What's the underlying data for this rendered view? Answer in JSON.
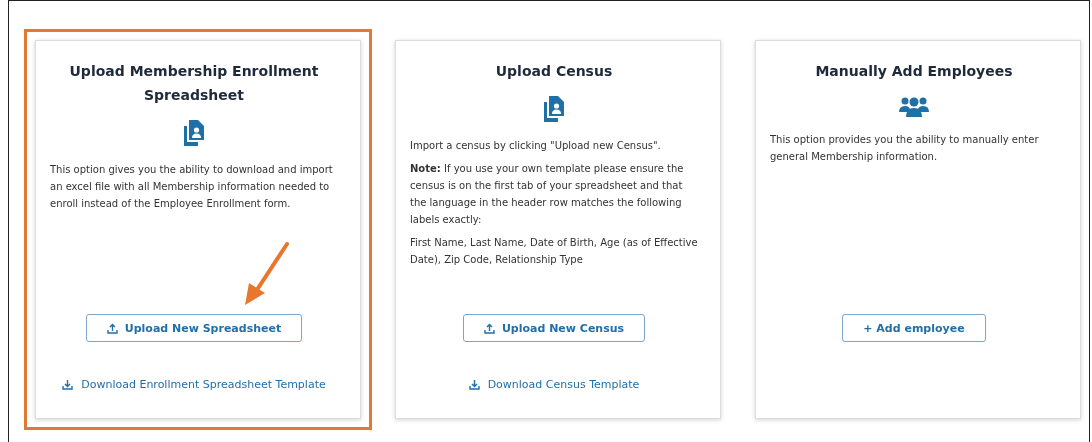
{
  "cards": [
    {
      "title": "Upload Membership Enrollment Spreadsheet",
      "highlighted": true,
      "pointer_arrow": true,
      "kind": "document",
      "paragraphs": [
        "This option gives you the ability to download and import an excel file with all Membership information needed to enroll instead of the Employee Enrollment form."
      ],
      "button": {
        "label": "Upload New Spreadsheet",
        "kind": "upload"
      },
      "link": {
        "label": "Download Enrollment Spreadsheet Template"
      }
    },
    {
      "title": "Upload Census",
      "highlighted": false,
      "pointer_arrow": false,
      "kind": "document",
      "paragraphs": [
        "Import a census by clicking \"Upload new Census\".",
        "**Note:** If you use your own template please ensure the census is on the first tab of your spreadsheet and that the language in the header row matches the following labels exactly:",
        "First Name, Last Name, Date of Birth, Age (as of Effective Date), Zip Code, Relationship Type"
      ],
      "button": {
        "label": "Upload New Census",
        "kind": "upload"
      },
      "link": {
        "label": "Download Census Template"
      }
    },
    {
      "title": "Manually Add Employees",
      "highlighted": false,
      "pointer_arrow": false,
      "kind": "people",
      "paragraphs": [
        "This option provides you the ability to manually enter general Membership information."
      ],
      "button": {
        "label": "+ Add employee",
        "kind": "add"
      }
    }
  ]
}
